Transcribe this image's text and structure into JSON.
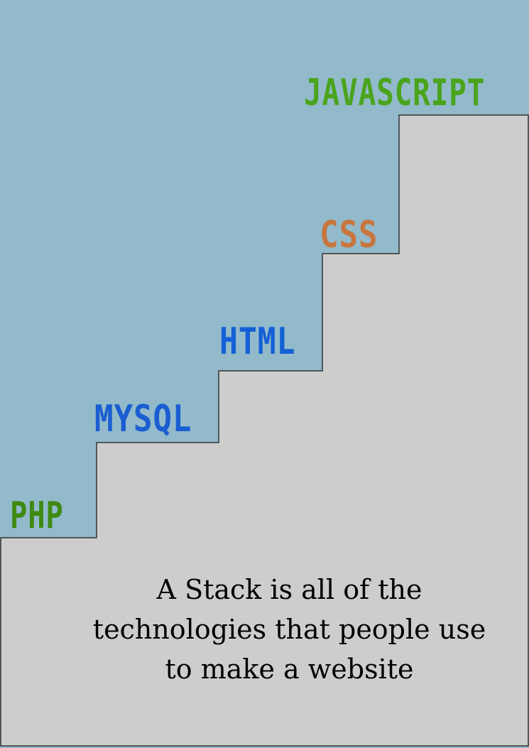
{
  "steps": [
    {
      "label": "PHP",
      "color": "#3f8a12"
    },
    {
      "label": "MYSQL",
      "color": "#1a5ed1"
    },
    {
      "label": "HTML",
      "color": "#1560d6"
    },
    {
      "label": "CSS",
      "color": "#c8763e"
    },
    {
      "label": "JAVASCRIPT",
      "color": "#4aa41c"
    }
  ],
  "caption": {
    "lines": [
      "A Stack is all of the",
      "technologies that people use",
      "to make a website"
    ]
  },
  "colors": {
    "sky": "#92bacb",
    "stairs": "#cdcdcd",
    "stair_outline": "#333333"
  }
}
